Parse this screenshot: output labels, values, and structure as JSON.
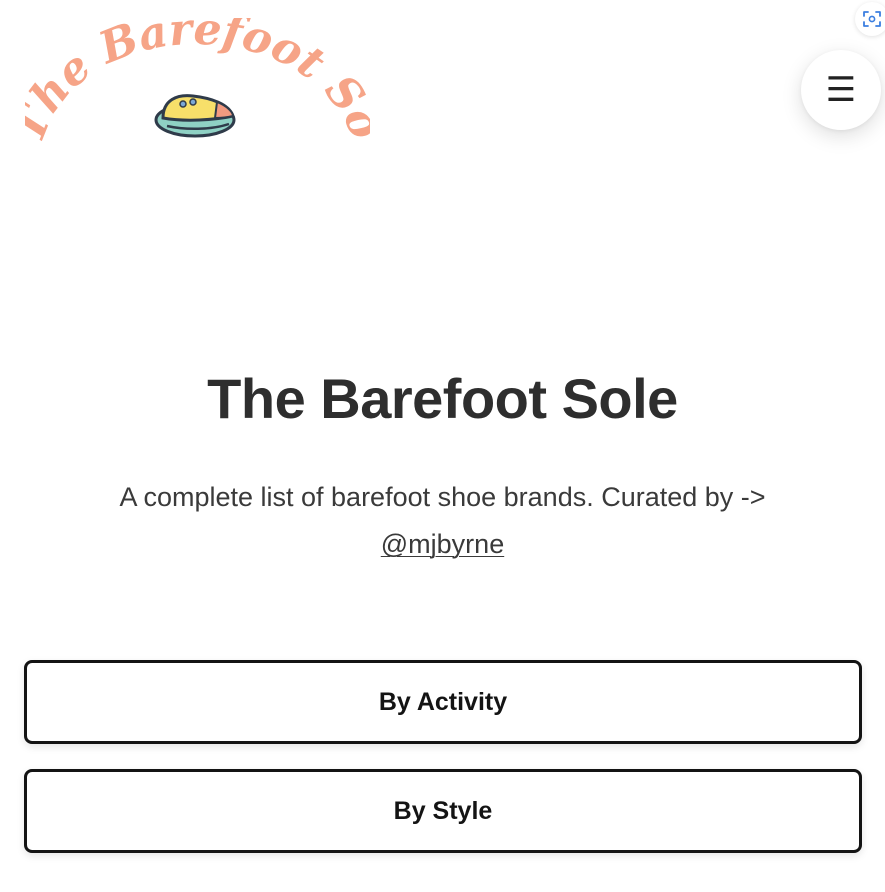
{
  "logo": {
    "text": "The Barefoot Sole",
    "alt": "The Barefoot Sole logo",
    "color": "#f6a487",
    "shoe_colors": {
      "upper": "#f7df6a",
      "sole": "#8fd1c4",
      "accent": "#f29a80",
      "outline": "#2f3b4a",
      "lace": "#7aa7d6"
    }
  },
  "corner_icon": {
    "name": "scan-icon",
    "color": "#3b7ee0"
  },
  "menu": {
    "glyph": "☰",
    "label": "Menu"
  },
  "hero": {
    "title": "The Barefoot Sole",
    "subtitle": "A complete list of barefoot shoe brands. Curated by ->",
    "author_link": "@mjbyrne"
  },
  "buttons": [
    {
      "label": "By Activity"
    },
    {
      "label": "By Style"
    }
  ]
}
